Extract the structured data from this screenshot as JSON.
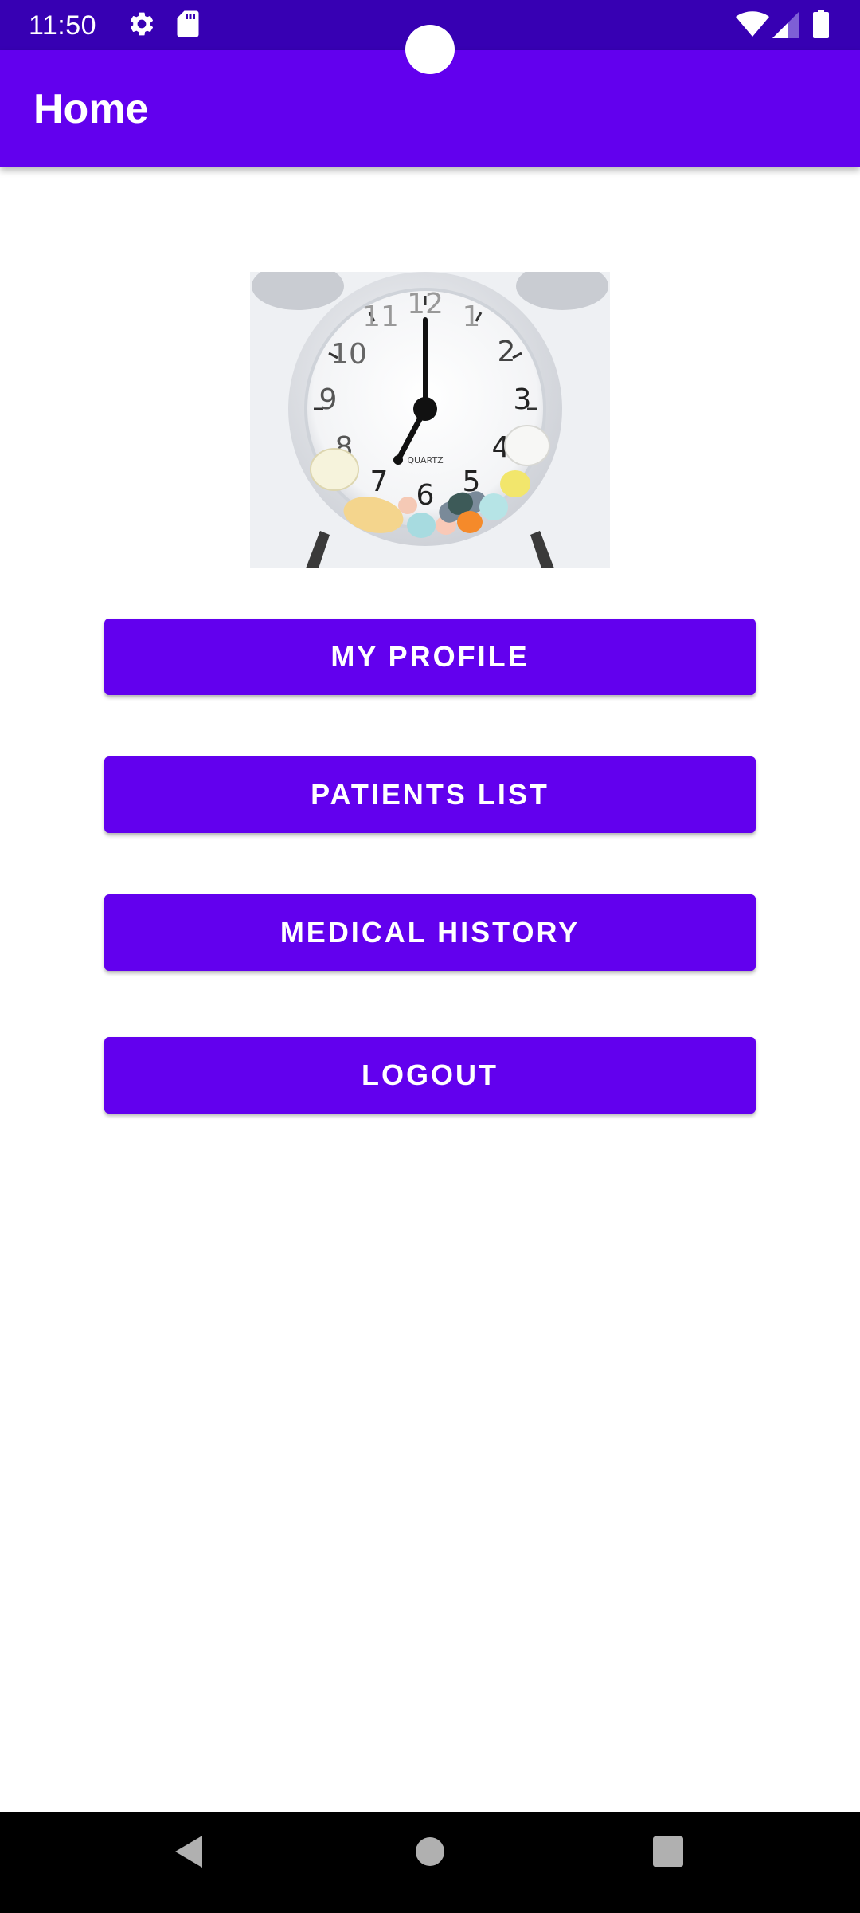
{
  "status_bar": {
    "time": "11:50",
    "left_icons": [
      "gear-icon",
      "sd-card-icon"
    ],
    "right_icons": [
      "wifi-icon",
      "cellular-signal-icon",
      "battery-icon"
    ]
  },
  "app_bar": {
    "title": "Home"
  },
  "hero_image": {
    "description_icon": "alarm-clock-with-pills-image",
    "clock_numerals": [
      "12",
      "1",
      "2",
      "3",
      "4",
      "5",
      "6",
      "7",
      "8",
      "9",
      "10",
      "11"
    ],
    "clock_label": "QUARTZ"
  },
  "buttons": {
    "my_profile": "MY PROFILE",
    "patients_list": "PATIENTS LIST",
    "medical_history": "MEDICAL HISTORY",
    "logout": "LOGOUT"
  },
  "nav_bar": {
    "icons": [
      "back-icon",
      "home-icon",
      "recents-icon"
    ]
  },
  "colors": {
    "primary": "#6200ee",
    "primary_dark": "#3700b3",
    "on_primary": "#ffffff",
    "background": "#ffffff"
  }
}
